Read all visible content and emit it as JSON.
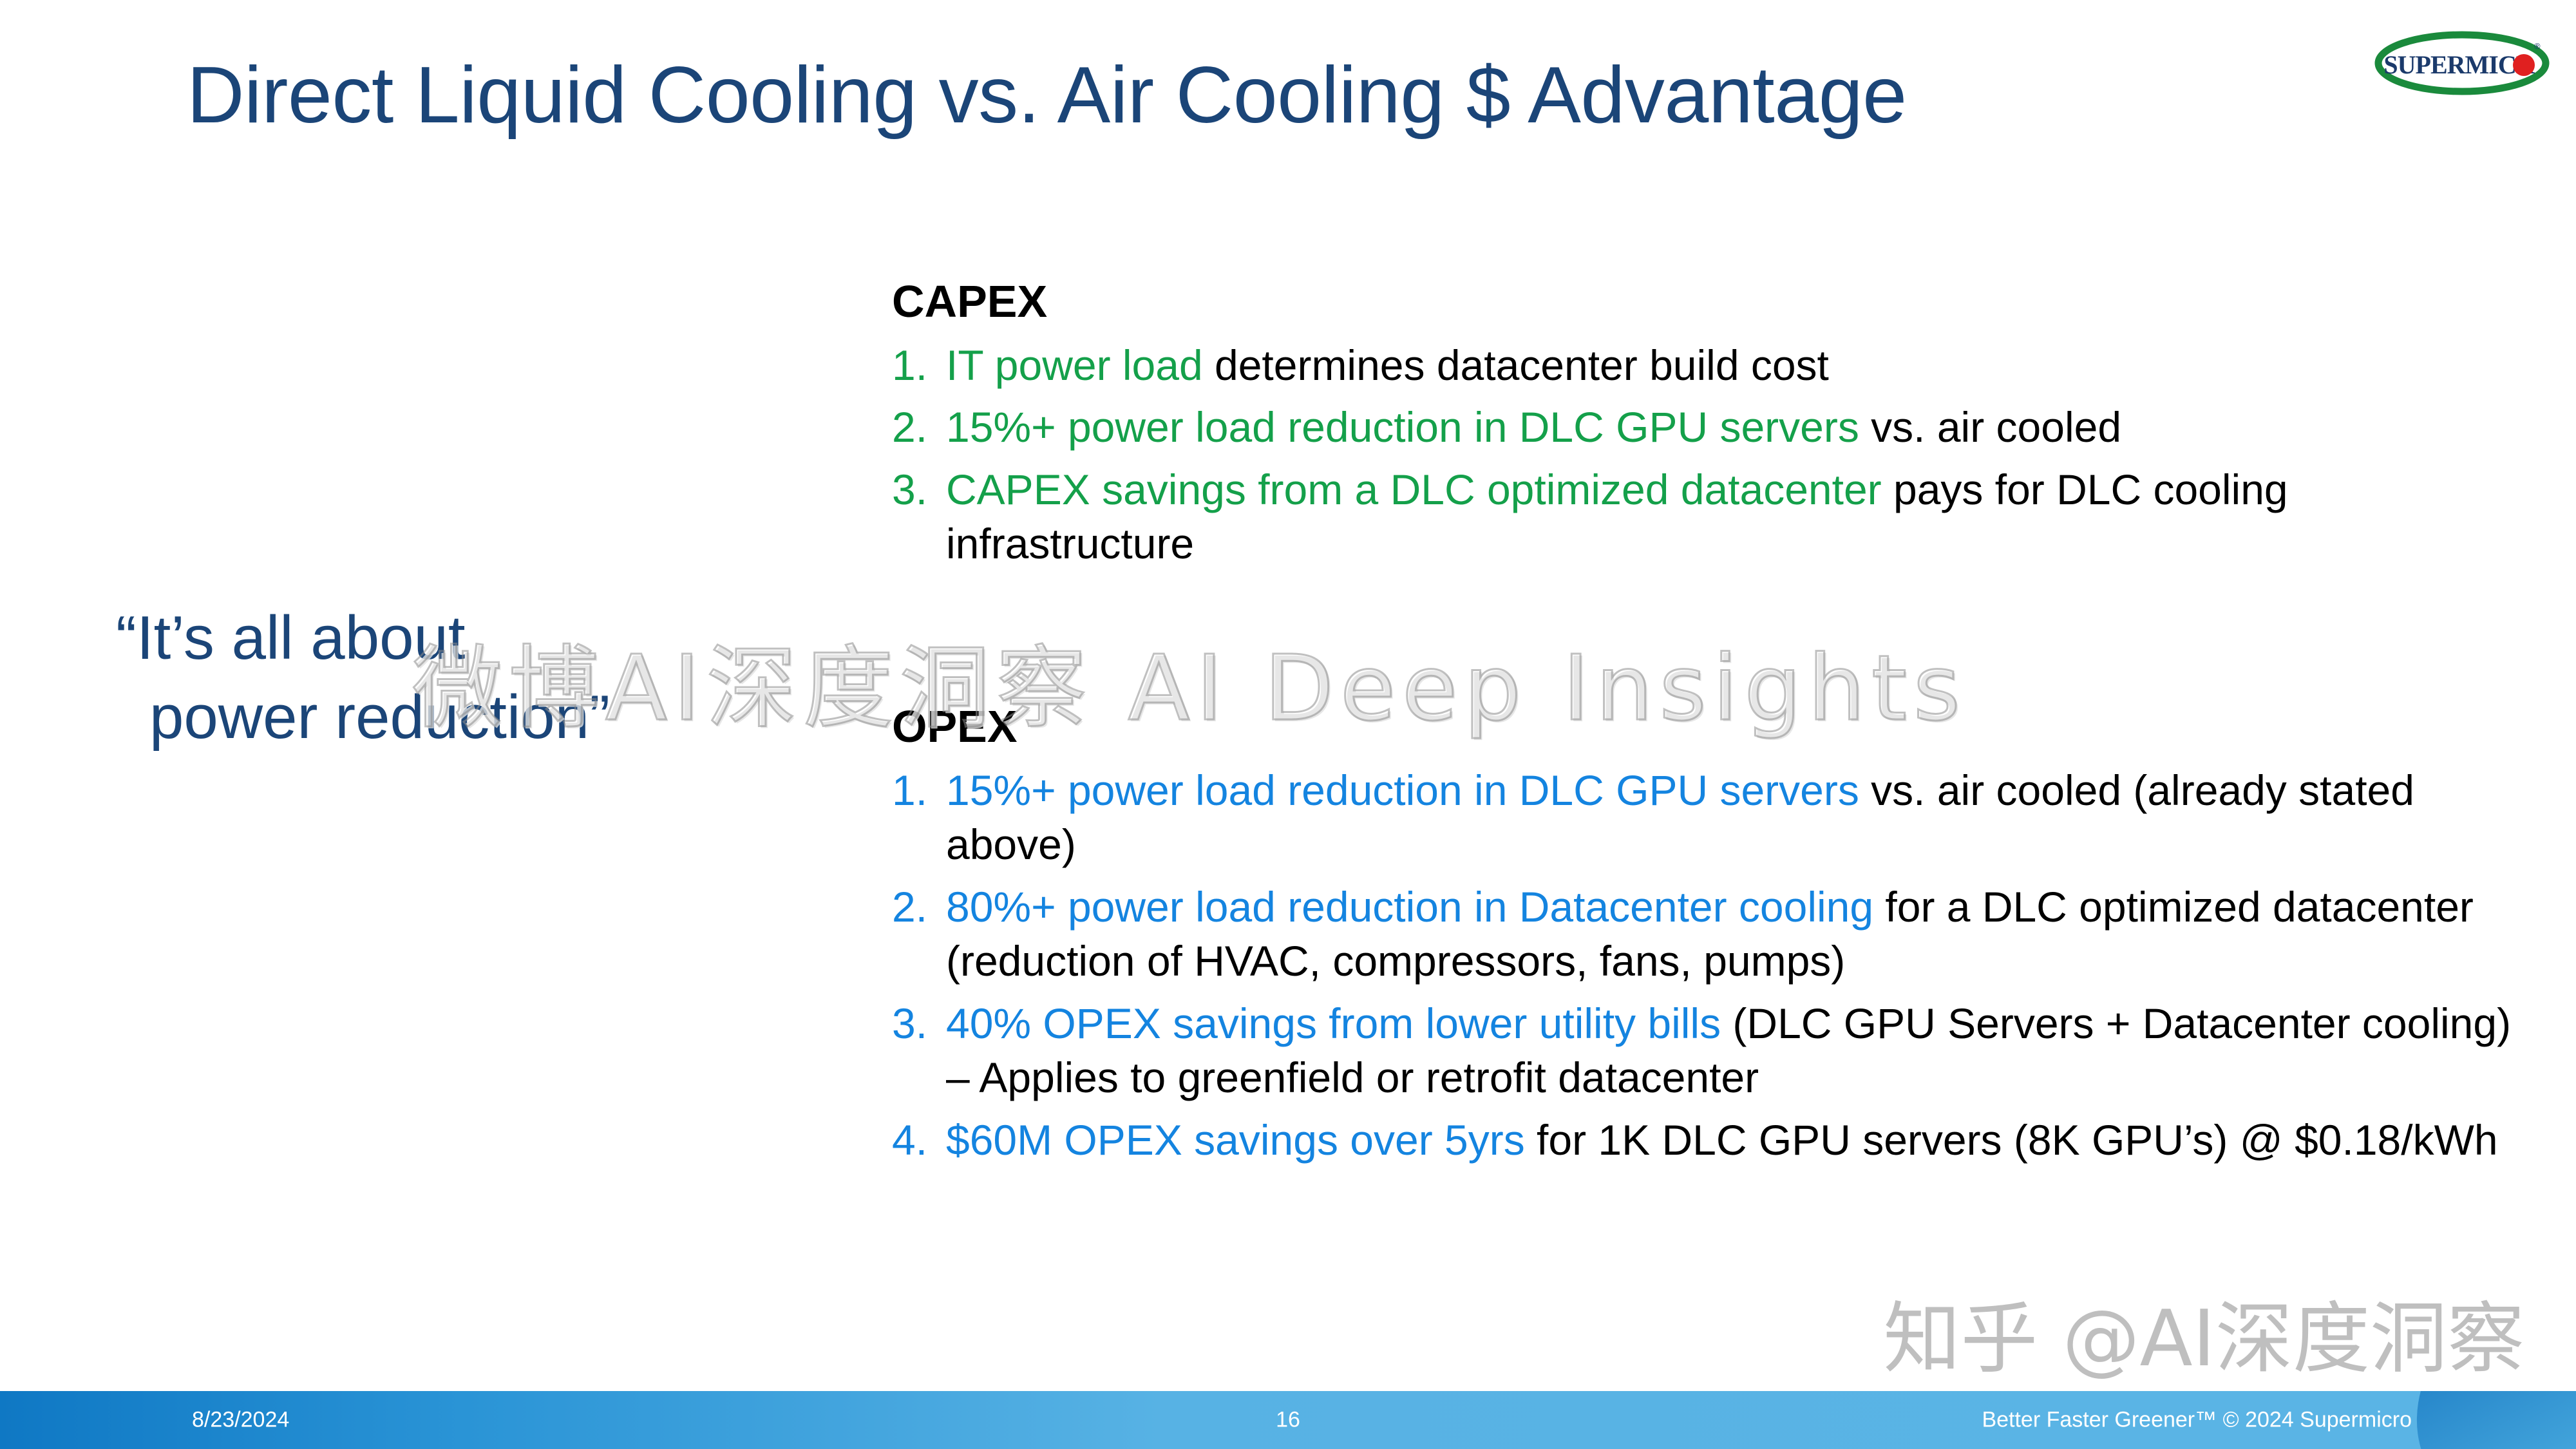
{
  "slide": {
    "title": "Direct Liquid Cooling vs. Air Cooling $ Advantage",
    "quote_line1": "“It’s all about",
    "quote_line2": "power reduction”"
  },
  "logo": {
    "name": "supermicro-logo",
    "wordmark": "SUPERMICRO",
    "registered": "®",
    "ellipse_color": "#1a8a3c",
    "text_color": "#1b3a6b",
    "dot_color": "#e02020"
  },
  "capex": {
    "heading": "CAPEX",
    "items": [
      {
        "marker": "1.",
        "highlight": "IT power load",
        "rest": " determines datacenter build cost"
      },
      {
        "marker": "2.",
        "highlight": "15%+ power load reduction in DLC GPU servers",
        "rest": " vs. air cooled"
      },
      {
        "marker": "3.",
        "highlight": "CAPEX savings from a DLC optimized datacenter",
        "rest": " pays for DLC cooling infrastructure"
      }
    ],
    "highlight_color": "#14a04a"
  },
  "opex": {
    "heading": "OPEX",
    "items": [
      {
        "marker": "1.",
        "highlight": "15%+ power load reduction in DLC GPU servers",
        "rest": " vs. air cooled (already stated above)"
      },
      {
        "marker": "2.",
        "highlight": "80%+ power load reduction in Datacenter cooling",
        "rest": " for a DLC optimized datacenter (reduction of HVAC, compressors, fans, pumps)"
      },
      {
        "marker": "3.",
        "highlight": "40% OPEX savings from lower utility bills",
        "rest": " (DLC GPU Servers + Datacenter cooling) – Applies to greenfield or retrofit datacenter"
      },
      {
        "marker": "4.",
        "highlight": "$60M OPEX savings over 5yrs",
        "rest": " for 1K DLC GPU servers (8K GPU’s) @ $0.18/kWh"
      }
    ],
    "highlight_color": "#1484e0"
  },
  "footer": {
    "date": "8/23/2024",
    "page_number": "16",
    "tagline": "Better Faster Greener™  © 2024 Supermicro",
    "bar_color_left": "#0f78c4",
    "bar_color_right": "#5ab4e5"
  },
  "watermarks": {
    "center": "微博AI深度洞察  AI Deep Insights",
    "corner": "知乎 @AI深度洞察"
  }
}
